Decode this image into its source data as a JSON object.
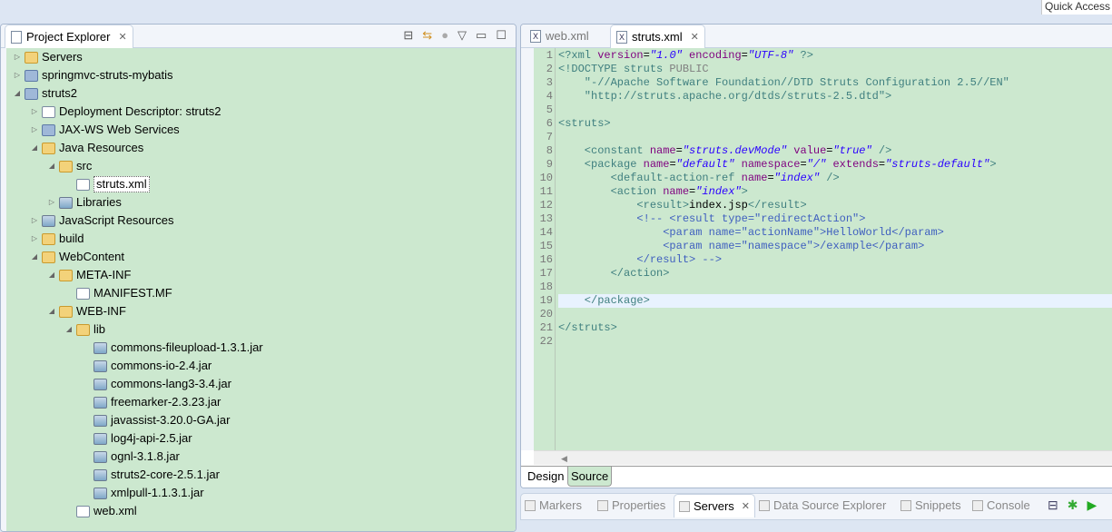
{
  "quick_access": "Quick Access",
  "explorer": {
    "title": "Project Explorer",
    "items": [
      {
        "label": "Servers",
        "level": 0,
        "state": "collapsed",
        "icon": "folder"
      },
      {
        "label": "springmvc-struts-mybatis",
        "level": 0,
        "state": "collapsed",
        "icon": "proj"
      },
      {
        "label": "struts2",
        "level": 0,
        "state": "expanded",
        "icon": "proj"
      },
      {
        "label": "Deployment Descriptor: struts2",
        "level": 1,
        "state": "collapsed",
        "icon": "file"
      },
      {
        "label": "JAX-WS Web Services",
        "level": 1,
        "state": "collapsed",
        "icon": "proj"
      },
      {
        "label": "Java Resources",
        "level": 1,
        "state": "expanded",
        "icon": "folder"
      },
      {
        "label": "src",
        "level": 2,
        "state": "expanded",
        "icon": "folder"
      },
      {
        "label": "struts.xml",
        "level": 3,
        "state": "leaf",
        "icon": "file",
        "selected": true
      },
      {
        "label": "Libraries",
        "level": 2,
        "state": "collapsed",
        "icon": "jar"
      },
      {
        "label": "JavaScript Resources",
        "level": 1,
        "state": "collapsed",
        "icon": "jar"
      },
      {
        "label": "build",
        "level": 1,
        "state": "collapsed",
        "icon": "folder"
      },
      {
        "label": "WebContent",
        "level": 1,
        "state": "expanded",
        "icon": "folder"
      },
      {
        "label": "META-INF",
        "level": 2,
        "state": "expanded",
        "icon": "folder"
      },
      {
        "label": "MANIFEST.MF",
        "level": 3,
        "state": "leaf",
        "icon": "file"
      },
      {
        "label": "WEB-INF",
        "level": 2,
        "state": "expanded",
        "icon": "folder"
      },
      {
        "label": "lib",
        "level": 3,
        "state": "expanded",
        "icon": "folder"
      },
      {
        "label": "commons-fileupload-1.3.1.jar",
        "level": 4,
        "state": "leaf",
        "icon": "jar"
      },
      {
        "label": "commons-io-2.4.jar",
        "level": 4,
        "state": "leaf",
        "icon": "jar"
      },
      {
        "label": "commons-lang3-3.4.jar",
        "level": 4,
        "state": "leaf",
        "icon": "jar"
      },
      {
        "label": "freemarker-2.3.23.jar",
        "level": 4,
        "state": "leaf",
        "icon": "jar"
      },
      {
        "label": "javassist-3.20.0-GA.jar",
        "level": 4,
        "state": "leaf",
        "icon": "jar"
      },
      {
        "label": "log4j-api-2.5.jar",
        "level": 4,
        "state": "leaf",
        "icon": "jar"
      },
      {
        "label": "ognl-3.1.8.jar",
        "level": 4,
        "state": "leaf",
        "icon": "jar"
      },
      {
        "label": "struts2-core-2.5.1.jar",
        "level": 4,
        "state": "leaf",
        "icon": "jar"
      },
      {
        "label": "xmlpull-1.1.3.1.jar",
        "level": 4,
        "state": "leaf",
        "icon": "jar"
      },
      {
        "label": "web.xml",
        "level": 3,
        "state": "leaf",
        "icon": "file"
      }
    ]
  },
  "editor": {
    "tabs": [
      {
        "label": "web.xml",
        "active": false
      },
      {
        "label": "struts.xml",
        "active": true
      }
    ],
    "current_line": 19,
    "lines": [
      [
        [
          "t",
          "<?xml "
        ],
        [
          "a",
          "version"
        ],
        [
          "p",
          "="
        ],
        [
          "v",
          "\"1.0\""
        ],
        [
          "a",
          " encoding"
        ],
        [
          "p",
          "="
        ],
        [
          "v",
          "\"UTF-8\""
        ],
        [
          "t",
          " ?>"
        ]
      ],
      [
        [
          "t",
          "<!DOCTYPE struts "
        ],
        [
          "d",
          "PUBLIC"
        ]
      ],
      [
        [
          "t",
          "    \"-//Apache Software Foundation//DTD Struts Configuration 2.5//EN\""
        ]
      ],
      [
        [
          "t",
          "    \"http://struts.apache.org/dtds/struts-2.5.dtd\">"
        ]
      ],
      [],
      [
        [
          "t",
          "<struts>"
        ]
      ],
      [],
      [
        [
          "t",
          "    <constant "
        ],
        [
          "a",
          "name"
        ],
        [
          "p",
          "="
        ],
        [
          "v",
          "\"struts.devMode\""
        ],
        [
          "a",
          " value"
        ],
        [
          "p",
          "="
        ],
        [
          "v",
          "\"true\""
        ],
        [
          "t",
          " />"
        ]
      ],
      [
        [
          "t",
          "    <package "
        ],
        [
          "a",
          "name"
        ],
        [
          "p",
          "="
        ],
        [
          "v",
          "\"default\""
        ],
        [
          "a",
          " namespace"
        ],
        [
          "p",
          "="
        ],
        [
          "v",
          "\"/\""
        ],
        [
          "a",
          " extends"
        ],
        [
          "p",
          "="
        ],
        [
          "v",
          "\"struts-default\""
        ],
        [
          "t",
          ">"
        ]
      ],
      [
        [
          "t",
          "        <default-action-ref "
        ],
        [
          "a",
          "name"
        ],
        [
          "p",
          "="
        ],
        [
          "v",
          "\"index\""
        ],
        [
          "t",
          " />"
        ]
      ],
      [
        [
          "t",
          "        <action "
        ],
        [
          "a",
          "name"
        ],
        [
          "p",
          "="
        ],
        [
          "v",
          "\"index\""
        ],
        [
          "t",
          ">"
        ]
      ],
      [
        [
          "t",
          "            <result>"
        ],
        [
          "p",
          "index.jsp"
        ],
        [
          "t",
          "</result>"
        ]
      ],
      [
        [
          "c",
          "            <!-- <result type=\"redirectAction\">"
        ]
      ],
      [
        [
          "c",
          "                <param name=\"actionName\">HelloWorld</param>"
        ]
      ],
      [
        [
          "c",
          "                <param name=\"namespace\">/example</param>"
        ]
      ],
      [
        [
          "c",
          "            </result> -->"
        ]
      ],
      [
        [
          "t",
          "        </action>"
        ]
      ],
      [],
      [
        [
          "t",
          "    </package>"
        ]
      ],
      [],
      [
        [
          "t",
          "</struts>"
        ]
      ],
      []
    ],
    "page_tabs": [
      "Design",
      "Source"
    ],
    "active_page_tab": "Source"
  },
  "bottom": {
    "tabs": [
      {
        "label": "Markers"
      },
      {
        "label": "Properties"
      },
      {
        "label": "Servers",
        "active": true
      },
      {
        "label": "Data Source Explorer"
      },
      {
        "label": "Snippets"
      },
      {
        "label": "Console"
      }
    ]
  }
}
